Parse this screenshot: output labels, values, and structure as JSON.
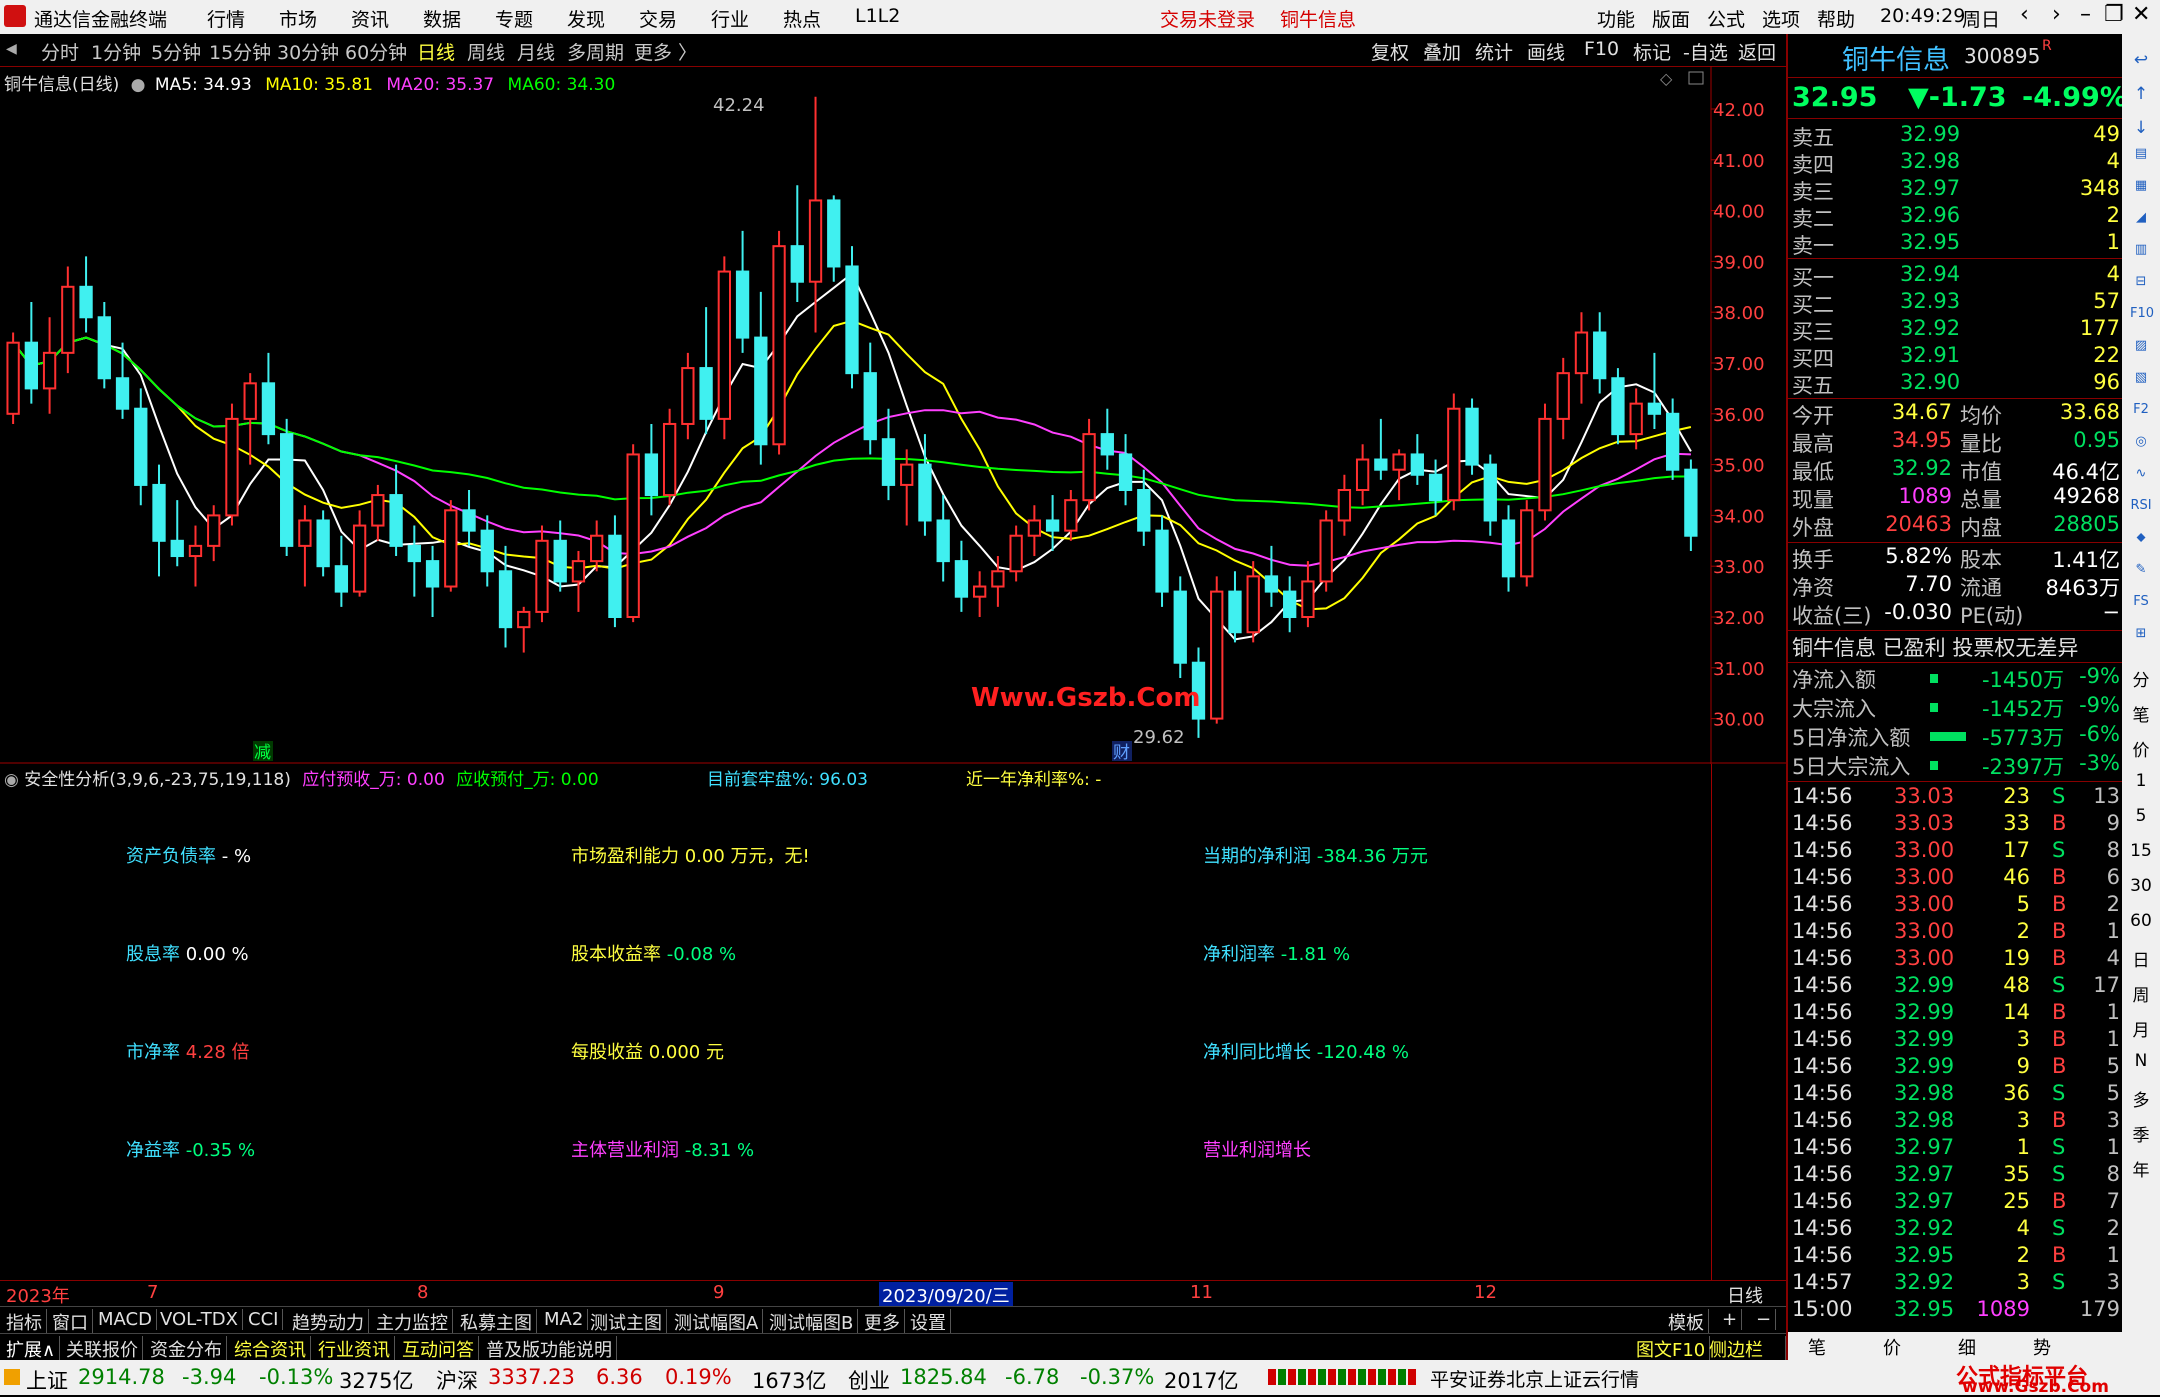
{
  "titlebar": {
    "app_name": "通达信金融终端",
    "menus": [
      "行情",
      "市场",
      "资讯",
      "数据",
      "专题",
      "发现",
      "交易",
      "行业",
      "热点",
      "L1L2"
    ],
    "trade_status": "交易未登录",
    "stock_title": "铜牛信息",
    "right_menus": [
      "功能",
      "版面",
      "公式",
      "选项",
      "帮助"
    ],
    "time": "20:49:29",
    "weekday": "周日"
  },
  "periodbar": {
    "periods": [
      "分时",
      "1分钟",
      "5分钟",
      "15分钟",
      "30分钟",
      "60分钟",
      "日线",
      "周线",
      "月线",
      "多周期",
      "更多 〉"
    ],
    "active": "日线",
    "tools": [
      "复权",
      "叠加",
      "统计",
      "画线",
      "F10",
      "标记",
      "-自选",
      "返回"
    ]
  },
  "chart": {
    "title": "铜牛信息(日线)",
    "ma": [
      {
        "label": "MA5: 34.93",
        "color": "#ffffff"
      },
      {
        "label": "MA10: 35.81",
        "color": "#ffff00"
      },
      {
        "label": "MA20: 35.37",
        "color": "#ff40ff"
      },
      {
        "label": "MA60: 34.30",
        "color": "#00ff00"
      }
    ],
    "high_label": "42.24",
    "low_label": "29.62",
    "watermark": "Www.Gszb.Com",
    "marker_jian": "减",
    "marker_cai": "财",
    "price_ticks": [
      "42.00",
      "41.00",
      "40.00",
      "39.00",
      "38.00",
      "37.00",
      "36.00",
      "35.00",
      "34.00",
      "33.00",
      "32.00",
      "31.00",
      "30.00"
    ]
  },
  "chart_data": {
    "type": "candlestick",
    "ylim": [
      29.5,
      42.5
    ],
    "ohlc": [
      [
        36.0,
        37.6,
        35.8,
        37.4
      ],
      [
        37.4,
        38.2,
        36.2,
        36.5
      ],
      [
        36.5,
        37.9,
        36.0,
        37.2
      ],
      [
        37.2,
        38.9,
        36.8,
        38.5
      ],
      [
        38.5,
        39.1,
        37.6,
        37.9
      ],
      [
        37.9,
        38.2,
        36.5,
        36.7
      ],
      [
        36.7,
        37.4,
        35.9,
        36.1
      ],
      [
        36.1,
        36.5,
        34.2,
        34.6
      ],
      [
        34.6,
        35.0,
        32.8,
        33.5
      ],
      [
        33.5,
        34.3,
        33.0,
        33.2
      ],
      [
        33.2,
        33.8,
        32.6,
        33.4
      ],
      [
        33.4,
        34.2,
        33.1,
        34.0
      ],
      [
        34.0,
        36.2,
        33.8,
        35.9
      ],
      [
        35.9,
        36.8,
        35.0,
        36.6
      ],
      [
        36.6,
        37.2,
        35.4,
        35.6
      ],
      [
        35.6,
        35.9,
        33.2,
        33.4
      ],
      [
        33.4,
        34.2,
        32.6,
        33.9
      ],
      [
        33.9,
        34.1,
        32.8,
        33.0
      ],
      [
        33.0,
        33.6,
        32.2,
        32.5
      ],
      [
        32.5,
        34.1,
        32.4,
        33.8
      ],
      [
        33.8,
        34.6,
        33.5,
        34.4
      ],
      [
        34.4,
        35.0,
        33.2,
        33.4
      ],
      [
        33.4,
        33.8,
        32.4,
        33.1
      ],
      [
        33.1,
        33.4,
        32.0,
        32.6
      ],
      [
        32.6,
        34.3,
        32.5,
        34.1
      ],
      [
        34.1,
        34.5,
        33.4,
        33.7
      ],
      [
        33.7,
        34.0,
        32.6,
        32.9
      ],
      [
        32.9,
        33.4,
        31.4,
        31.8
      ],
      [
        31.8,
        32.2,
        31.3,
        32.1
      ],
      [
        32.1,
        33.8,
        31.9,
        33.5
      ],
      [
        33.5,
        33.9,
        32.5,
        32.7
      ],
      [
        32.7,
        33.3,
        32.1,
        33.1
      ],
      [
        33.1,
        33.9,
        32.9,
        33.6
      ],
      [
        33.6,
        34.0,
        31.8,
        32.0
      ],
      [
        32.0,
        35.4,
        31.9,
        35.2
      ],
      [
        35.2,
        35.8,
        34.0,
        34.4
      ],
      [
        34.4,
        36.1,
        34.2,
        35.8
      ],
      [
        35.8,
        37.2,
        35.5,
        36.9
      ],
      [
        36.9,
        38.1,
        35.6,
        35.9
      ],
      [
        35.9,
        39.1,
        35.5,
        38.8
      ],
      [
        38.8,
        39.6,
        37.2,
        37.5
      ],
      [
        37.5,
        38.4,
        35.0,
        35.4
      ],
      [
        35.4,
        39.6,
        35.2,
        39.3
      ],
      [
        39.3,
        40.5,
        38.2,
        38.6
      ],
      [
        38.6,
        42.24,
        37.6,
        40.2
      ],
      [
        40.2,
        40.3,
        38.6,
        38.9
      ],
      [
        38.9,
        39.3,
        36.5,
        36.8
      ],
      [
        36.8,
        37.4,
        35.2,
        35.5
      ],
      [
        35.5,
        36.1,
        34.3,
        34.6
      ],
      [
        34.6,
        35.3,
        33.8,
        35.0
      ],
      [
        35.0,
        35.6,
        33.6,
        33.9
      ],
      [
        33.9,
        34.4,
        32.7,
        33.1
      ],
      [
        33.1,
        33.5,
        32.1,
        32.4
      ],
      [
        32.4,
        32.9,
        32.0,
        32.6
      ],
      [
        32.6,
        33.2,
        32.2,
        32.9
      ],
      [
        32.9,
        33.8,
        32.7,
        33.6
      ],
      [
        33.6,
        34.2,
        33.2,
        33.9
      ],
      [
        33.9,
        34.4,
        33.3,
        33.7
      ],
      [
        33.7,
        34.5,
        33.5,
        34.3
      ],
      [
        34.3,
        35.9,
        34.1,
        35.6
      ],
      [
        35.6,
        36.1,
        34.9,
        35.2
      ],
      [
        35.2,
        35.6,
        34.2,
        34.5
      ],
      [
        34.5,
        34.9,
        33.4,
        33.7
      ],
      [
        33.7,
        34.0,
        32.2,
        32.5
      ],
      [
        32.5,
        32.8,
        30.8,
        31.1
      ],
      [
        31.1,
        31.4,
        29.62,
        30.0
      ],
      [
        30.0,
        32.8,
        29.9,
        32.5
      ],
      [
        32.5,
        32.9,
        31.5,
        31.7
      ],
      [
        31.7,
        33.1,
        31.5,
        32.8
      ],
      [
        32.8,
        33.4,
        32.2,
        32.5
      ],
      [
        32.5,
        32.8,
        31.7,
        32.0
      ],
      [
        32.0,
        33.1,
        31.8,
        32.7
      ],
      [
        32.7,
        34.1,
        32.5,
        33.9
      ],
      [
        33.9,
        34.8,
        33.6,
        34.5
      ],
      [
        34.5,
        35.4,
        34.2,
        35.1
      ],
      [
        35.1,
        35.9,
        34.7,
        34.9
      ],
      [
        34.9,
        35.3,
        34.3,
        35.2
      ],
      [
        35.2,
        35.6,
        34.6,
        34.8
      ],
      [
        34.8,
        35.1,
        34.0,
        34.3
      ],
      [
        34.3,
        36.4,
        34.1,
        36.1
      ],
      [
        36.1,
        36.3,
        34.8,
        35.0
      ],
      [
        35.0,
        35.2,
        33.6,
        33.9
      ],
      [
        33.9,
        34.2,
        32.5,
        32.8
      ],
      [
        32.8,
        34.3,
        32.6,
        34.1
      ],
      [
        34.1,
        36.2,
        33.9,
        35.9
      ],
      [
        35.9,
        37.1,
        35.5,
        36.8
      ],
      [
        36.8,
        38.0,
        36.2,
        37.6
      ],
      [
        37.6,
        38.0,
        36.4,
        36.7
      ],
      [
        36.7,
        36.9,
        35.4,
        35.6
      ],
      [
        35.6,
        36.5,
        35.3,
        36.2
      ],
      [
        36.2,
        37.2,
        35.7,
        36.0
      ],
      [
        36.0,
        36.3,
        34.7,
        34.9
      ],
      [
        34.9,
        35.1,
        33.3,
        33.6
      ]
    ]
  },
  "indicator": {
    "name": "安全性分析(3,9,6,-23,75,19,118)",
    "head_items": [
      {
        "label": "应付预收_万: 0.00",
        "color": "#ff40ff"
      },
      {
        "label": "应收预付_万: 0.00",
        "color": "#00ff00"
      },
      {
        "label": "目前套牢盘%: 96.03",
        "color": "#40e0ff"
      },
      {
        "label": "近一年净利率%: -",
        "color": "#ffff40"
      }
    ],
    "items": [
      {
        "key": "资产负债率",
        "val": " - %",
        "kc": "#40e0ff",
        "vc": "#ffffff"
      },
      {
        "key": "市场盈利能力",
        "val": " 0.00 万元，无!",
        "kc": "#ffff40",
        "vc": "#ffff40"
      },
      {
        "key": "当期的净利润",
        "val": " -384.36 万元",
        "kc": "#40e0ff",
        "vc": "#00ff80"
      },
      {
        "key": "股息率",
        "val": " 0.00 %",
        "kc": "#40e0ff",
        "vc": "#ffffff"
      },
      {
        "key": "股本收益率",
        "val": " -0.08 %",
        "kc": "#ffff40",
        "vc": "#00ff80"
      },
      {
        "key": "净利润率",
        "val": " -1.81 %",
        "kc": "#40e0ff",
        "vc": "#00ff80"
      },
      {
        "key": "市净率",
        "val": " 4.28 倍",
        "kc": "#40e0ff",
        "vc": "#ff4040"
      },
      {
        "key": "每股收益",
        "val": " 0.000 元",
        "kc": "#ffff40",
        "vc": "#ffff40"
      },
      {
        "key": "净利同比增长",
        "val": " -120.48 %",
        "kc": "#40e0ff",
        "vc": "#00ff80"
      },
      {
        "key": "净益率",
        "val": " -0.35 %",
        "kc": "#40e0ff",
        "vc": "#00ff80"
      },
      {
        "key": "主体营业利润",
        "val": " -8.31 %",
        "kc": "#ff40ff",
        "vc": "#00ff80"
      },
      {
        "key": "营业利润增长",
        "val": "",
        "kc": "#ff40ff",
        "vc": "#00ff80"
      }
    ]
  },
  "dateaxis": {
    "labels": [
      {
        "text": "2023年"
      },
      {
        "text": "7"
      },
      {
        "text": "8"
      },
      {
        "text": "9"
      },
      {
        "text": "2023/09/20/三"
      },
      {
        "text": "11"
      },
      {
        "text": "12"
      }
    ],
    "right": "日线"
  },
  "tabs1": [
    "指标",
    "窗口",
    "MACD",
    "VOL-TDX",
    "CCI",
    "趋势动力",
    "主力监控",
    "私募主图",
    "MA2",
    "测试主图",
    "测试幅图A",
    "测试幅图B",
    "更多",
    "设置"
  ],
  "tabs1_right": [
    "模板",
    "+",
    "−"
  ],
  "tabs2": [
    "扩展∧",
    "关联报价",
    "资金分布",
    "综合资讯",
    "行业资讯",
    "互动问答",
    "普及版功能说明"
  ],
  "tabs2_right": [
    "图文F10",
    "侧边栏 《"
  ],
  "quote": {
    "name": "铜牛信息",
    "code": "300895",
    "r": "R",
    "price": "32.95",
    "change": "▼-1.73",
    "pct": "-4.99%",
    "asks": [
      {
        "l": "卖五",
        "p": "32.99",
        "v": "49"
      },
      {
        "l": "卖四",
        "p": "32.98",
        "v": "4"
      },
      {
        "l": "卖三",
        "p": "32.97",
        "v": "348"
      },
      {
        "l": "卖二",
        "p": "32.96",
        "v": "2"
      },
      {
        "l": "卖一",
        "p": "32.95",
        "v": "1"
      }
    ],
    "bids": [
      {
        "l": "买一",
        "p": "32.94",
        "v": "4"
      },
      {
        "l": "买二",
        "p": "32.93",
        "v": "57"
      },
      {
        "l": "买三",
        "p": "32.92",
        "v": "177"
      },
      {
        "l": "买四",
        "p": "32.91",
        "v": "22"
      },
      {
        "l": "买五",
        "p": "32.90",
        "v": "96"
      }
    ],
    "stats": [
      {
        "l1": "今开",
        "v1": "34.67",
        "c1": "#ffff40",
        "l2": "均价",
        "v2": "33.68",
        "c2": "#ffff40"
      },
      {
        "l1": "最高",
        "v1": "34.95",
        "c1": "#ff4040",
        "l2": "量比",
        "v2": "0.95",
        "c2": "#00e060"
      },
      {
        "l1": "最低",
        "v1": "32.92",
        "c1": "#00e060",
        "l2": "市值",
        "v2": "46.4亿",
        "c2": "#ffffff"
      },
      {
        "l1": "现量",
        "v1": "1089",
        "c1": "#ff40ff",
        "l2": "总量",
        "v2": "49268",
        "c2": "#ffffff"
      },
      {
        "l1": "外盘",
        "v1": "20463",
        "c1": "#ff4040",
        "l2": "内盘",
        "v2": "28805",
        "c2": "#00e060"
      }
    ],
    "stats2": [
      {
        "l1": "换手",
        "v1": "5.82%",
        "l2": "股本",
        "v2": "1.41亿"
      },
      {
        "l1": "净资",
        "v1": "7.70",
        "l2": "流通",
        "v2": "8463万"
      },
      {
        "l1": "收益(三)",
        "v1": "-0.030",
        "l2": "PE(动)",
        "v2": "−"
      }
    ],
    "tags": "铜牛信息 已盈利 投票权无差异",
    "flows": [
      {
        "l": "净流入额",
        "v": "-1450万",
        "p": "-9%",
        "bar": 8
      },
      {
        "l": "大宗流入",
        "v": "-1452万",
        "p": "-9%",
        "bar": 8
      },
      {
        "l": "5日净流入额",
        "v": "-5773万",
        "p": "-6%",
        "bar": 36
      },
      {
        "l": "5日大宗流入",
        "v": "-2397万",
        "p": "-3%",
        "bar": 8
      }
    ],
    "ticks": [
      {
        "t": "14:56",
        "p": "33.03",
        "v": "23",
        "s": "S",
        "n": "13"
      },
      {
        "t": "14:56",
        "p": "33.03",
        "v": "33",
        "s": "B",
        "n": "9"
      },
      {
        "t": "14:56",
        "p": "33.00",
        "v": "17",
        "s": "S",
        "n": "8"
      },
      {
        "t": "14:56",
        "p": "33.00",
        "v": "46",
        "s": "B",
        "n": "6"
      },
      {
        "t": "14:56",
        "p": "33.00",
        "v": "5",
        "s": "B",
        "n": "2"
      },
      {
        "t": "14:56",
        "p": "33.00",
        "v": "2",
        "s": "B",
        "n": "1"
      },
      {
        "t": "14:56",
        "p": "33.00",
        "v": "19",
        "s": "B",
        "n": "4"
      },
      {
        "t": "14:56",
        "p": "32.99",
        "v": "48",
        "s": "S",
        "n": "17"
      },
      {
        "t": "14:56",
        "p": "32.99",
        "v": "14",
        "s": "B",
        "n": "1"
      },
      {
        "t": "14:56",
        "p": "32.99",
        "v": "3",
        "s": "B",
        "n": "1"
      },
      {
        "t": "14:56",
        "p": "32.99",
        "v": "9",
        "s": "B",
        "n": "5"
      },
      {
        "t": "14:56",
        "p": "32.98",
        "v": "36",
        "s": "S",
        "n": "5"
      },
      {
        "t": "14:56",
        "p": "32.98",
        "v": "3",
        "s": "B",
        "n": "3"
      },
      {
        "t": "14:56",
        "p": "32.97",
        "v": "1",
        "s": "S",
        "n": "1"
      },
      {
        "t": "14:56",
        "p": "32.97",
        "v": "35",
        "s": "S",
        "n": "8"
      },
      {
        "t": "14:56",
        "p": "32.97",
        "v": "25",
        "s": "B",
        "n": "7"
      },
      {
        "t": "14:56",
        "p": "32.92",
        "v": "4",
        "s": "S",
        "n": "2"
      },
      {
        "t": "14:56",
        "p": "32.95",
        "v": "2",
        "s": "B",
        "n": "1"
      },
      {
        "t": "14:57",
        "p": "32.92",
        "v": "3",
        "s": "S",
        "n": "3"
      },
      {
        "t": "15:00",
        "p": "32.95",
        "v": "1089",
        "s": "",
        "n": "179"
      }
    ],
    "bottom_tabs": [
      "笔",
      "价",
      "细",
      "势"
    ]
  },
  "sidebar_items": [
    "分",
    "笔",
    "价",
    "1",
    "5",
    "15",
    "30",
    "60",
    "日",
    "周",
    "月",
    "N",
    "多",
    "季",
    "年"
  ],
  "statusbar": {
    "indices": [
      {
        "name": "上证",
        "v": "2914.78",
        "c": "-3.94",
        "p": "-0.13%",
        "a": "3275亿"
      },
      {
        "name": "沪深",
        "v": "3337.23",
        "c": "6.36",
        "p": "0.19%",
        "a": "1673亿"
      },
      {
        "name": "创业",
        "v": "1825.84",
        "c": "-6.78",
        "p": "-0.37%",
        "a": "2017亿"
      }
    ],
    "broker": "平安证券北京上证云行情",
    "brand": "公式指标平台",
    "brand_url": "www.Gszb.Com"
  }
}
